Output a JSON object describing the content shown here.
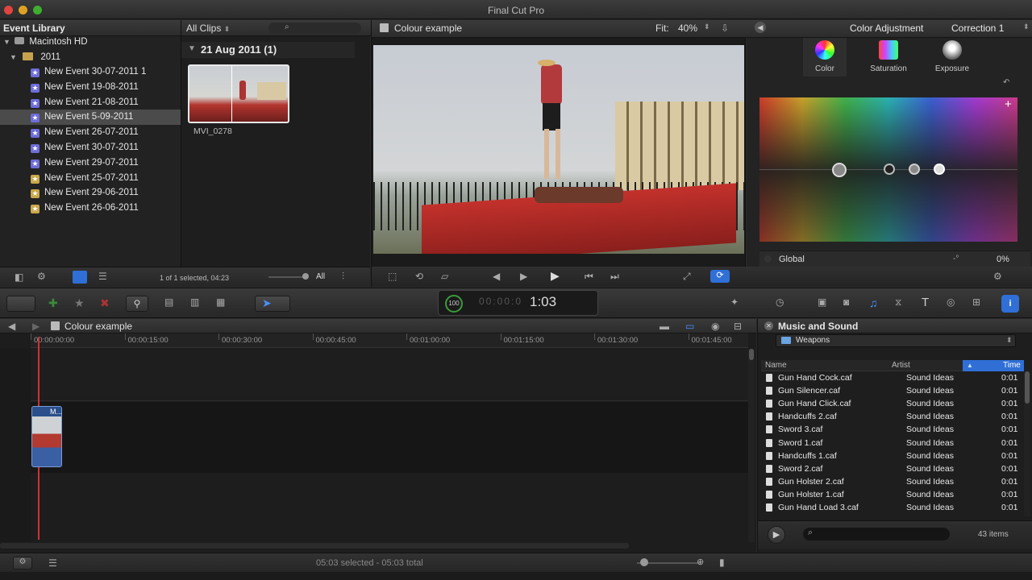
{
  "app": {
    "title": "Final Cut Pro"
  },
  "event_library": {
    "header": "Event Library",
    "filter": "All Clips",
    "drive": "Macintosh HD",
    "year": "2011",
    "events": [
      {
        "label": "New Event 30-07-2011 1",
        "icon": "star-icon",
        "selected": false
      },
      {
        "label": "New Event 19-08-2011",
        "icon": "star-icon",
        "selected": false
      },
      {
        "label": "New Event 21-08-2011",
        "icon": "star-icon",
        "selected": false
      },
      {
        "label": "New Event 5-09-2011",
        "icon": "star-icon",
        "selected": true
      },
      {
        "label": "New Event 26-07-2011",
        "icon": "star-icon",
        "selected": false
      },
      {
        "label": "New Event 30-07-2011",
        "icon": "star-icon",
        "selected": false
      },
      {
        "label": "New Event 29-07-2011",
        "icon": "star-icon",
        "selected": false
      },
      {
        "label": "New Event 25-07-2011",
        "icon": "warning-star-icon",
        "selected": false
      },
      {
        "label": "New Event 29-06-2011",
        "icon": "warning-star-icon",
        "selected": false
      },
      {
        "label": "New Event 26-06-2011",
        "icon": "warning-star-icon",
        "selected": false
      }
    ]
  },
  "browser": {
    "date_header": "21 Aug 2011  (1)",
    "clip_name": "MVI_0278",
    "status": "1 of 1 selected, 04:23",
    "view_filter": "All"
  },
  "viewer": {
    "title": "Colour example",
    "fit_label": "Fit:",
    "fit_value": "40%"
  },
  "inspector": {
    "title": "Color Adjustment",
    "preset": "Correction 1",
    "tabs": [
      "Color",
      "Saturation",
      "Exposure"
    ],
    "global_label": "Global",
    "global_value": "0%",
    "global_angle": "-°"
  },
  "toolbar": {
    "timecode": "1:03",
    "percent": "100"
  },
  "timeline": {
    "project": "Colour example",
    "ruler": [
      "00:00:00:00",
      "00:00:15:00",
      "00:00:30:00",
      "00:00:45:00",
      "00:01:00:00",
      "00:01:15:00",
      "00:01:30:00",
      "00:01:45:00"
    ],
    "clip_label": "M...",
    "status": "05:03 selected - 05:03 total"
  },
  "music": {
    "title": "Music and Sound",
    "folder": "Weapons",
    "columns": [
      "Name",
      "Artist",
      "Time"
    ],
    "rows": [
      {
        "name": "Gun Hand Cock.caf",
        "artist": "Sound Ideas",
        "time": "0:01"
      },
      {
        "name": "Gun Silencer.caf",
        "artist": "Sound Ideas",
        "time": "0:01"
      },
      {
        "name": "Gun Hand Click.caf",
        "artist": "Sound Ideas",
        "time": "0:01"
      },
      {
        "name": "Handcuffs 2.caf",
        "artist": "Sound Ideas",
        "time": "0:01"
      },
      {
        "name": "Sword 3.caf",
        "artist": "Sound Ideas",
        "time": "0:01"
      },
      {
        "name": "Sword 1.caf",
        "artist": "Sound Ideas",
        "time": "0:01"
      },
      {
        "name": "Handcuffs 1.caf",
        "artist": "Sound Ideas",
        "time": "0:01"
      },
      {
        "name": "Sword 2.caf",
        "artist": "Sound Ideas",
        "time": "0:01"
      },
      {
        "name": "Gun Holster 2.caf",
        "artist": "Sound Ideas",
        "time": "0:01"
      },
      {
        "name": "Gun Holster 1.caf",
        "artist": "Sound Ideas",
        "time": "0:01"
      },
      {
        "name": "Gun Hand Load 3.caf",
        "artist": "Sound Ideas",
        "time": "0:01"
      }
    ],
    "count": "43 items"
  },
  "colors": {
    "accent": "#2f6fd6",
    "selection": "#4b4b4b",
    "panel_bg": "#1e1e1e"
  }
}
